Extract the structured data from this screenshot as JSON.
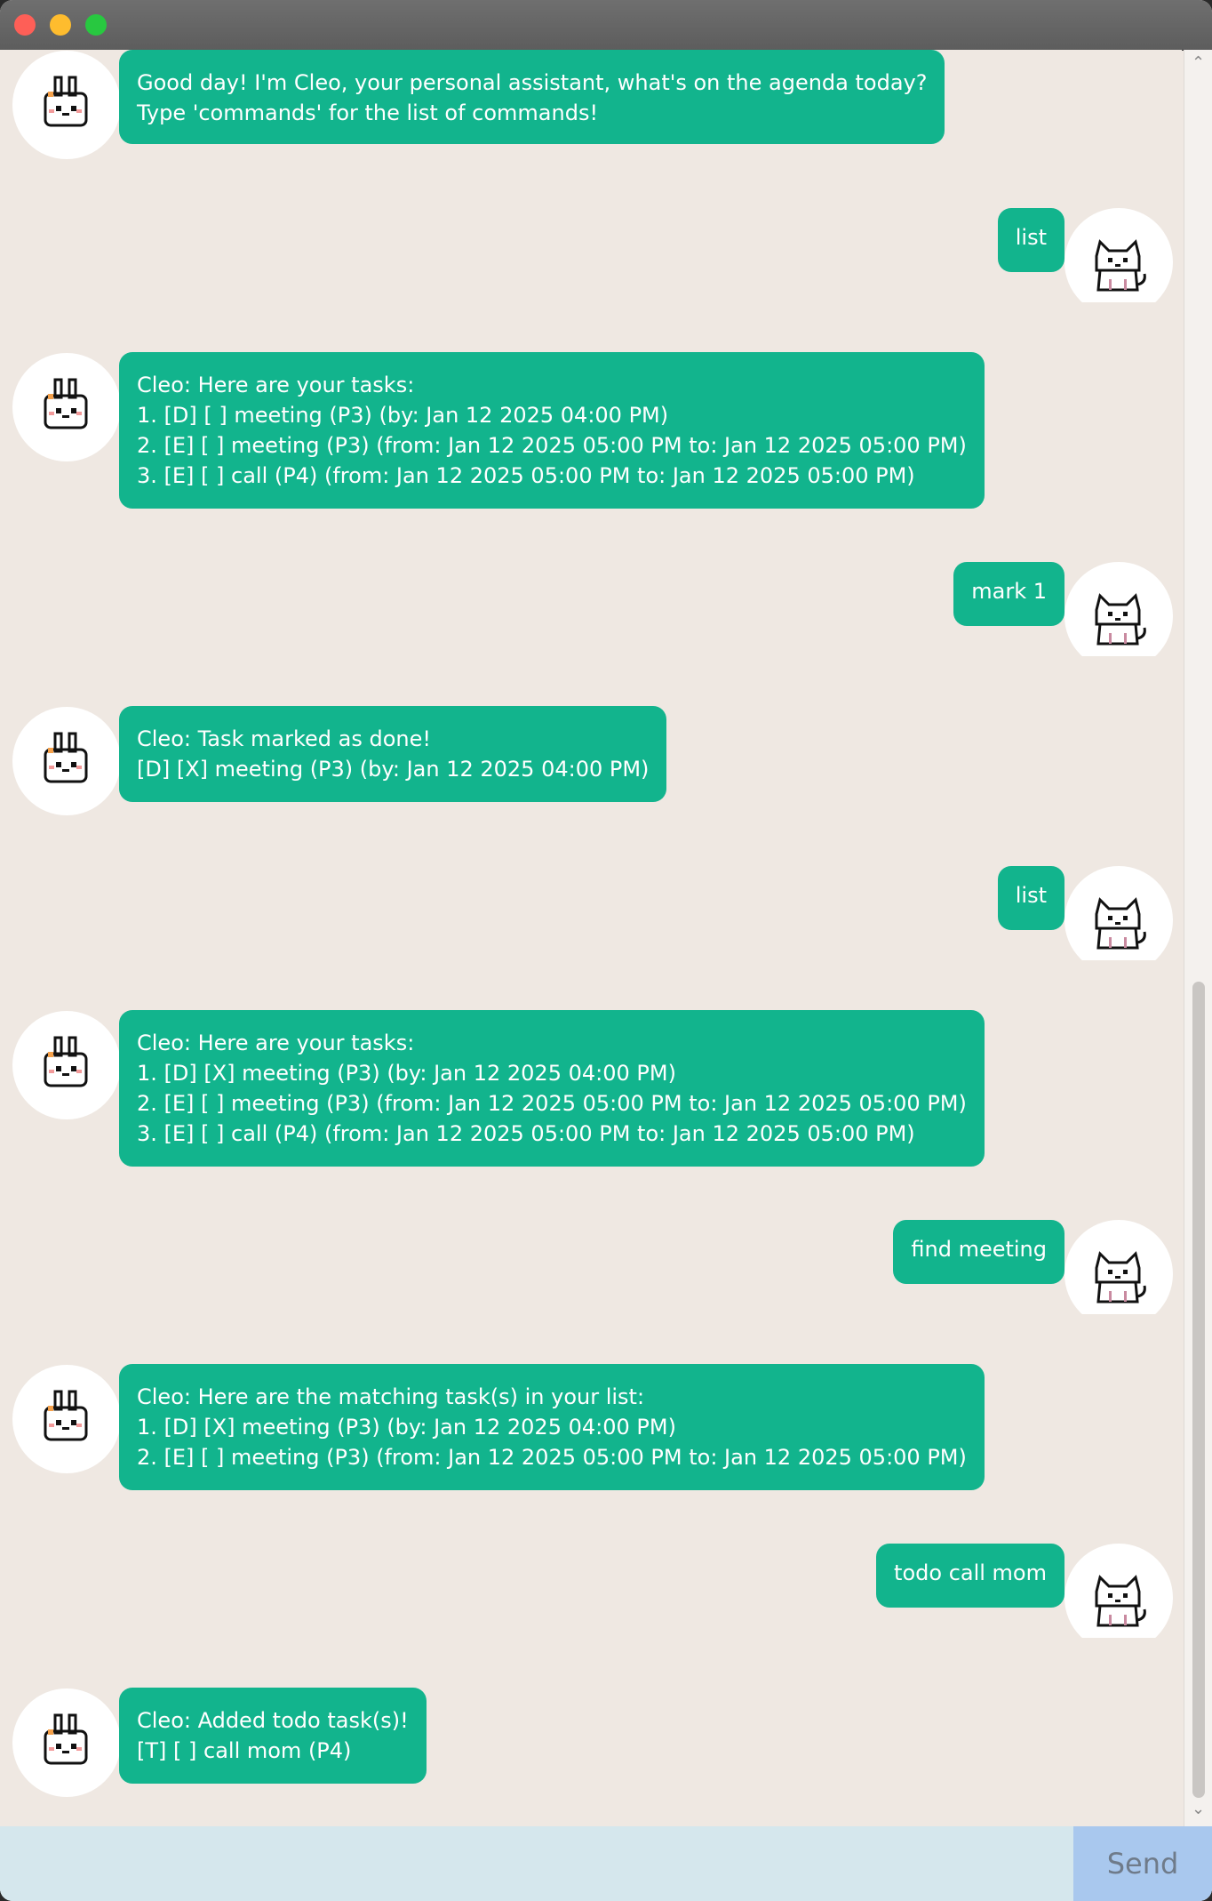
{
  "window": {
    "controls": [
      "close",
      "minimize",
      "zoom"
    ]
  },
  "chat": {
    "messages": [
      {
        "sender": "bot",
        "avatar_icon": "bunny-icon",
        "text": "Good day! I'm Cleo, your personal assistant, what's on the agenda today?\nType 'commands' for the list of commands!"
      },
      {
        "sender": "user",
        "avatar_icon": "cat-icon",
        "text": "list"
      },
      {
        "sender": "bot",
        "avatar_icon": "bunny-icon",
        "text": "Cleo: Here are your tasks:\n1. [D] [ ] meeting (P3) (by: Jan 12 2025 04:00 PM)\n2. [E] [ ] meeting (P3) (from: Jan 12 2025 05:00 PM to: Jan 12 2025 05:00 PM)\n3. [E] [ ] call (P4) (from: Jan 12 2025 05:00 PM to: Jan 12 2025 05:00 PM)"
      },
      {
        "sender": "user",
        "avatar_icon": "cat-icon",
        "text": "mark 1"
      },
      {
        "sender": "bot",
        "avatar_icon": "bunny-icon",
        "text": "Cleo: Task marked as done!\n[D] [X] meeting (P3) (by: Jan 12 2025 04:00 PM)"
      },
      {
        "sender": "user",
        "avatar_icon": "cat-icon",
        "text": "list"
      },
      {
        "sender": "bot",
        "avatar_icon": "bunny-icon",
        "text": "Cleo: Here are your tasks:\n1. [D] [X] meeting (P3) (by: Jan 12 2025 04:00 PM)\n2. [E] [ ] meeting (P3) (from: Jan 12 2025 05:00 PM to: Jan 12 2025 05:00 PM)\n3. [E] [ ] call (P4) (from: Jan 12 2025 05:00 PM to: Jan 12 2025 05:00 PM)"
      },
      {
        "sender": "user",
        "avatar_icon": "cat-icon",
        "text": "find meeting"
      },
      {
        "sender": "bot",
        "avatar_icon": "bunny-icon",
        "text": "Cleo: Here are the matching task(s) in your list:\n1. [D] [X] meeting (P3) (by: Jan 12 2025 04:00 PM)\n2. [E] [ ] meeting (P3) (from: Jan 12 2025 05:00 PM to: Jan 12 2025 05:00 PM)"
      },
      {
        "sender": "user",
        "avatar_icon": "cat-icon",
        "text": "todo call mom"
      },
      {
        "sender": "bot",
        "avatar_icon": "bunny-icon",
        "text": "Cleo: Added todo task(s)!\n[T] [ ] call mom (P4)"
      }
    ]
  },
  "input": {
    "value": "",
    "send_label": "Send"
  },
  "colors": {
    "bubble": "#12b48d",
    "background": "#efe8e2",
    "input_background": "#d5e7ed",
    "send_button": "#a9c8ee"
  }
}
